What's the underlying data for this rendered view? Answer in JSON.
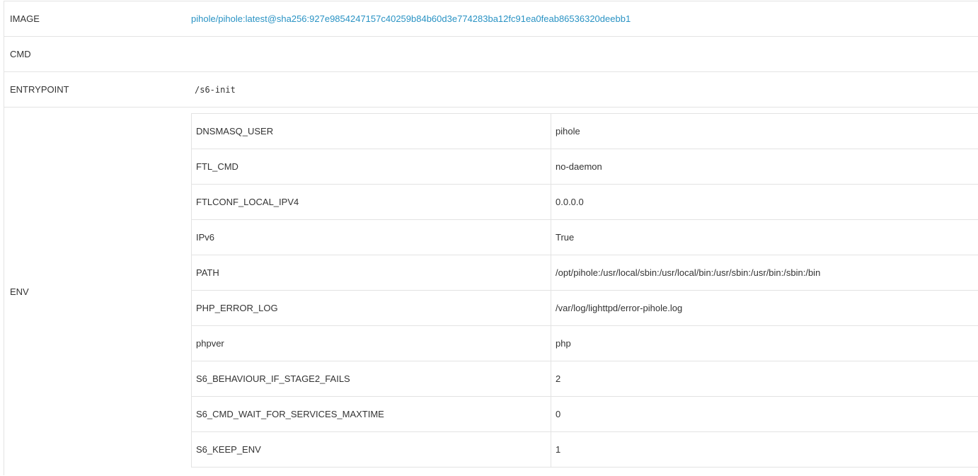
{
  "details": {
    "image": {
      "label": "IMAGE",
      "value": "pihole/pihole:latest@sha256:927e9854247157c40259b84b60d3e774283ba12fc91ea0feab86536320deebb1"
    },
    "cmd": {
      "label": "CMD",
      "value": ""
    },
    "entrypoint": {
      "label": "ENTRYPOINT",
      "value": "/s6-init"
    },
    "env": {
      "label": "ENV",
      "vars": [
        {
          "key": "DNSMASQ_USER",
          "value": "pihole"
        },
        {
          "key": "FTL_CMD",
          "value": "no-daemon"
        },
        {
          "key": "FTLCONF_LOCAL_IPV4",
          "value": "0.0.0.0"
        },
        {
          "key": "IPv6",
          "value": "True"
        },
        {
          "key": "PATH",
          "value": "/opt/pihole:/usr/local/sbin:/usr/local/bin:/usr/sbin:/usr/bin:/sbin:/bin"
        },
        {
          "key": "PHP_ERROR_LOG",
          "value": "/var/log/lighttpd/error-pihole.log"
        },
        {
          "key": "phpver",
          "value": "php"
        },
        {
          "key": "S6_BEHAVIOUR_IF_STAGE2_FAILS",
          "value": "2"
        },
        {
          "key": "S6_CMD_WAIT_FOR_SERVICES_MAXTIME",
          "value": "0"
        },
        {
          "key": "S6_KEEP_ENV",
          "value": "1"
        }
      ]
    }
  },
  "colors": {
    "link": "#2a93c4",
    "border": "#e3e3e3",
    "text": "#333333"
  }
}
